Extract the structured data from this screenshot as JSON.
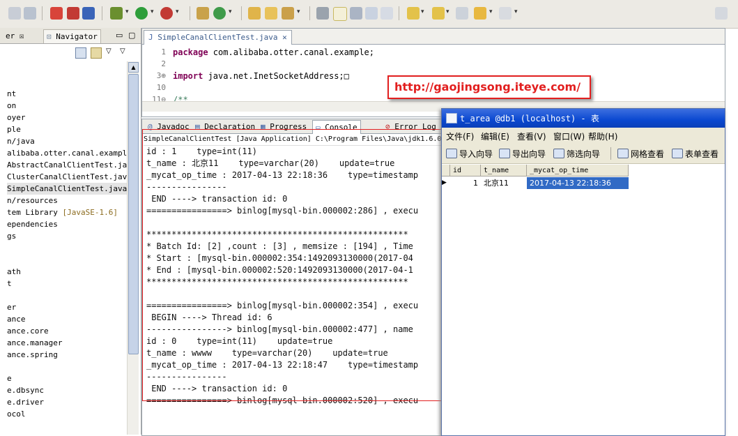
{
  "toolbar": {
    "icons": [
      "copy-icon",
      "print-icon",
      "skip-breakpoints-icon",
      "bug-icon",
      "debug-icon",
      "run-icon",
      "run-external-icon",
      "new-package-icon",
      "new-class-icon",
      "open-type-icon",
      "open-folder-icon",
      "search-icon",
      "toggle-mark-icon",
      "highlight-icon",
      "next-icon",
      "show-whitespace-icon",
      "next-annotation-icon",
      "prev-annotation-icon",
      "back-icon",
      "forward-icon",
      "maximize-icon"
    ]
  },
  "left_view": {
    "tab_partial": "er",
    "navigator_label": "Navigator",
    "tree": [
      {
        "text": "nt"
      },
      {
        "text": "on"
      },
      {
        "text": "oyer"
      },
      {
        "text": "ple"
      },
      {
        "text": "n/java"
      },
      {
        "text": "alibaba.otter.canal.example"
      },
      {
        "text": "AbstractCanalClientTest.java"
      },
      {
        "text": "ClusterCanalClientTest.java"
      },
      {
        "text": "SimpleCanalClientTest.java",
        "selected": true
      },
      {
        "text": "n/resources"
      },
      {
        "text": "tem Library ",
        "suffix": "[JavaSE-1.6]"
      },
      {
        "text": "ependencies"
      },
      {
        "text": "gs"
      },
      {
        "text": ""
      },
      {
        "text": ""
      },
      {
        "text": "ath"
      },
      {
        "text": "t"
      },
      {
        "text": ""
      },
      {
        "text": "er"
      },
      {
        "text": "ance"
      },
      {
        "text": "ance.core"
      },
      {
        "text": "ance.manager"
      },
      {
        "text": "ance.spring"
      },
      {
        "text": ""
      },
      {
        "text": "e"
      },
      {
        "text": "e.dbsync"
      },
      {
        "text": "e.driver"
      },
      {
        "text": "ocol"
      }
    ]
  },
  "editor": {
    "tab_label": "SimpleCanalClientTest.java",
    "lines": [
      {
        "num": "1",
        "kw": "package",
        "rest": " com.alibaba.otter.canal.example;"
      },
      {
        "num": "2",
        "kw": "",
        "rest": ""
      },
      {
        "num": "3⊕",
        "kw": "import",
        "rest": " java.net.InetSocketAddress;□"
      },
      {
        "num": "10",
        "kw": "",
        "rest": ""
      },
      {
        "num": "11⊖",
        "kw": "",
        "rest": "/**"
      }
    ]
  },
  "url_banner": "http://gaojingsong.iteye.com/",
  "bottom_view": {
    "tabs": [
      "Javadoc",
      "Declaration",
      "Progress",
      "Console",
      "Error Log"
    ],
    "console_header": "SimpleCanalClientTest [Java Application] C:\\Program Files\\Java\\jdk1.6.0",
    "console_lines": [
      "id : 1    type=int(11)",
      "t_name : 北京11    type=varchar(20)    update=true",
      "_mycat_op_time : 2017-04-13 22:18:36    type=timestamp",
      "----------------",
      " END ----> transaction id: 0",
      "================> binlog[mysql-bin.000002:286] , execu",
      "",
      "****************************************************",
      "* Batch Id: [2] ,count : [3] , memsize : [194] , Time",
      "* Start : [mysql-bin.000002:354:1492093130000(2017-04",
      "* End : [mysql-bin.000002:520:1492093130000(2017-04-1",
      "****************************************************",
      "",
      "================> binlog[mysql-bin.000002:354] , execu",
      " BEGIN ----> Thread id: 6",
      "----------------> binlog[mysql-bin.000002:477] , name",
      "id : 0    type=int(11)    update=true",
      "t_name : wwww    type=varchar(20)    update=true",
      "_mycat_op_time : 2017-04-13 22:18:47    type=timestamp",
      "----------------",
      " END ----> transaction id: 0",
      "================> binlog[mysql-bin.000002:520] , execu"
    ]
  },
  "db_window": {
    "title": "t_area @db1 (localhost) - 表",
    "menu": [
      "文件(F)",
      "编辑(E)",
      "查看(V)",
      "窗口(W)",
      "帮助(H)"
    ],
    "toolbar": [
      "导入向导",
      "导出向导",
      "筛选向导",
      "网格查看",
      "表单查看"
    ],
    "columns": [
      "id",
      "t_name",
      "_mycat_op_time"
    ],
    "rows": [
      {
        "id": "1",
        "t_name": "北京11",
        "op_time": "2017-04-13 22:18:36"
      }
    ]
  },
  "colors": {
    "highlight_red": "#e21f1f",
    "title_blue": "#0a48d0",
    "selection_blue": "#316ac5"
  }
}
